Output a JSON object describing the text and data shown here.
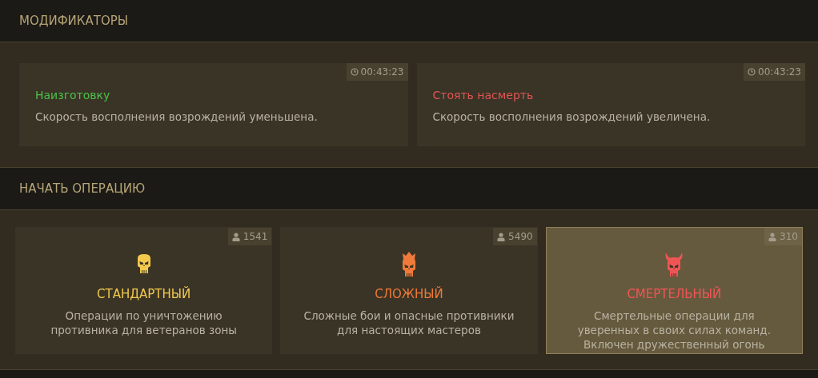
{
  "modifiers_section": {
    "title": "МОДИФИКАТОРЫ"
  },
  "modifiers": [
    {
      "timer": "00:43:23",
      "name": "Наизготовку",
      "color": "#4cc04a",
      "description": "Скорость восполнения возрождений уменьшена."
    },
    {
      "timer": "00:43:23",
      "name": "Стоять насмерть",
      "color": "#e05454",
      "description": "Скорость восполнения возрождений увеличена."
    }
  ],
  "operations_section": {
    "title": "НАЧАТЬ ОПЕРАЦИЮ"
  },
  "operations": [
    {
      "kind": "standard",
      "players": "1541",
      "name": "СТАНДАРТНЫЙ",
      "color": "#f2c94c",
      "description": "Операции по уничтожению\nпротивника для ветеранов зоны",
      "selected": false
    },
    {
      "kind": "hard",
      "players": "5490",
      "name": "СЛОЖНЫЙ",
      "color": "#f07a3a",
      "description": "Сложные бои и опасные противники\nдля настоящих мастеров",
      "selected": false
    },
    {
      "kind": "deadly",
      "players": "310",
      "name": "СМЕРТЕЛЬНЫЙ",
      "color": "#f05555",
      "description": "Смертельные операции для\nуверенных в своих силах команд.\nВключен дружественный огонь",
      "selected": true
    }
  ]
}
